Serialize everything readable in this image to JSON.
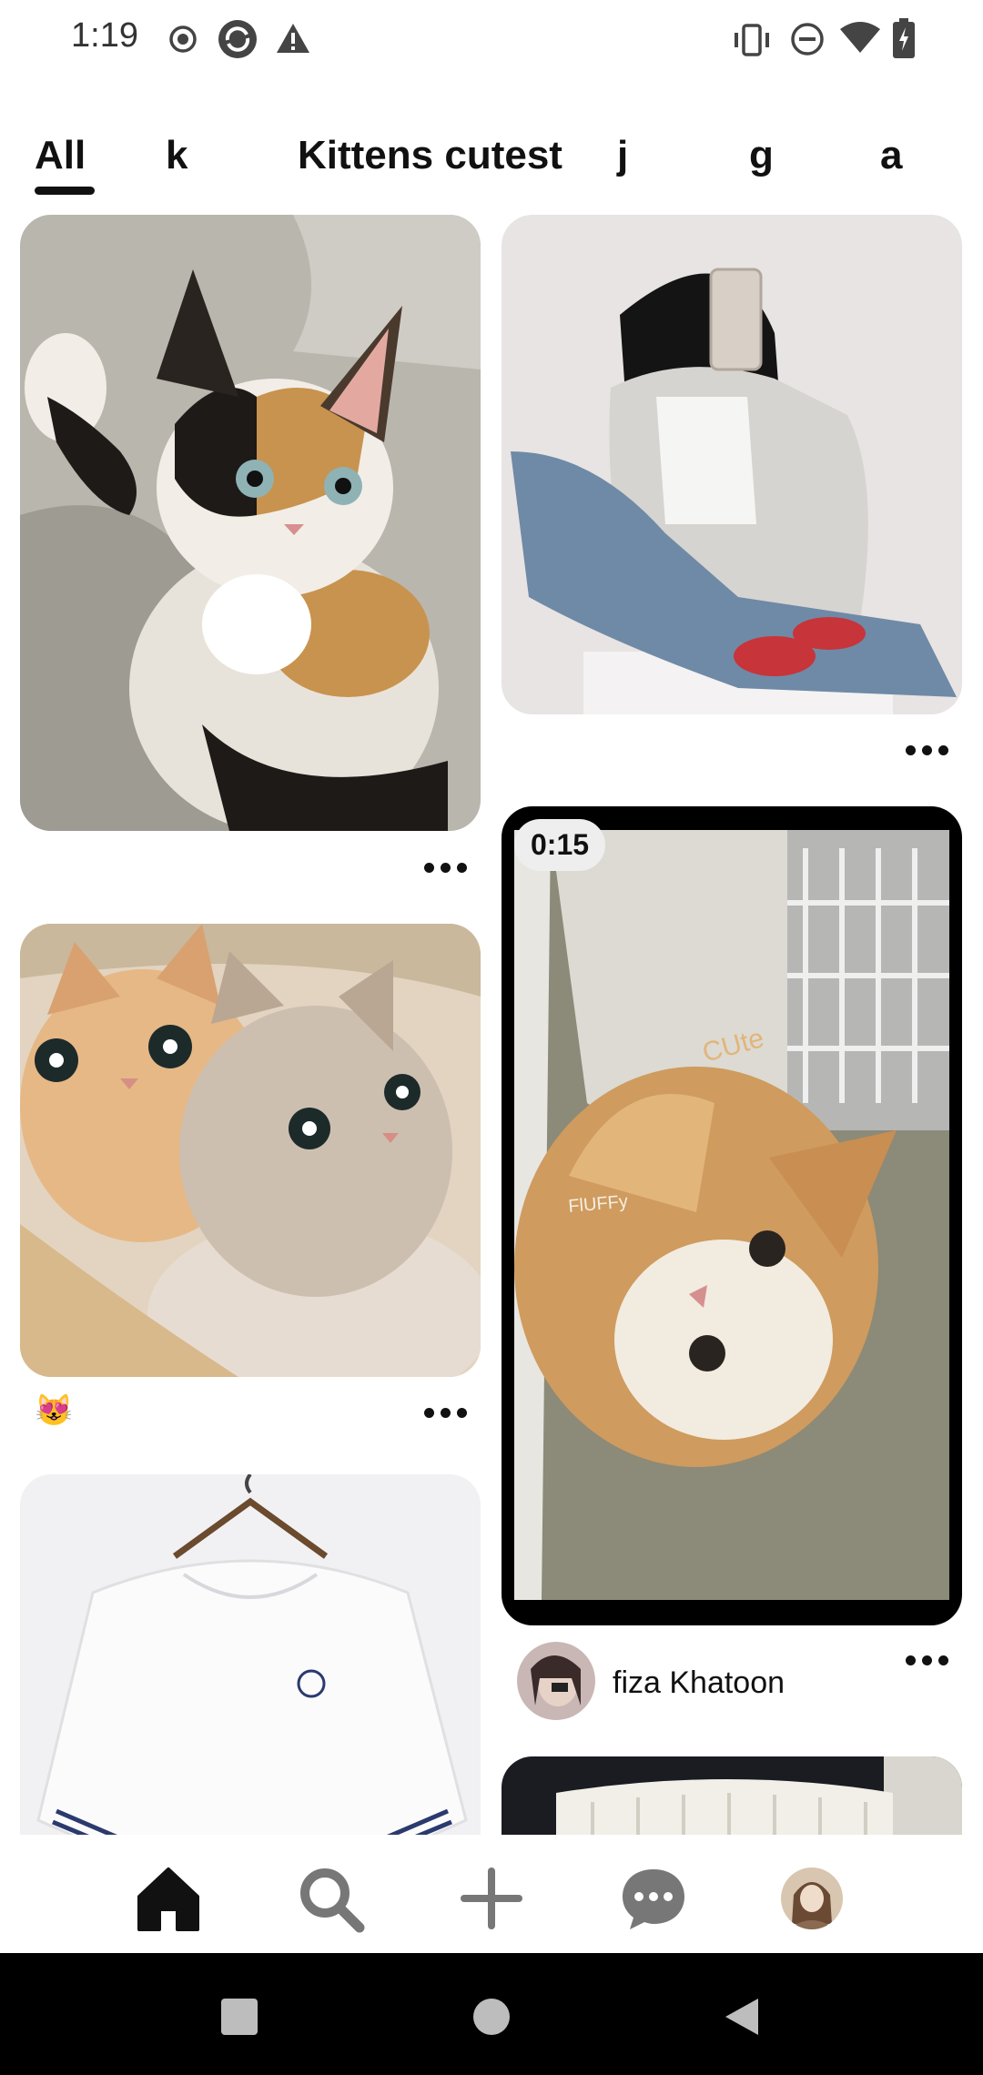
{
  "status_bar": {
    "time": "1:19",
    "left_icons": [
      "record-icon",
      "sync-icon",
      "warning-icon"
    ],
    "right_icons": [
      "vibrate-icon",
      "do-not-disturb-icon",
      "wifi-icon",
      "battery-icon"
    ]
  },
  "tabs": {
    "items": [
      {
        "label": "All",
        "selected": true
      },
      {
        "label": "k",
        "selected": false
      },
      {
        "label": "Kittens cutest",
        "selected": false
      },
      {
        "label": "j",
        "selected": false
      },
      {
        "label": "g",
        "selected": false
      },
      {
        "label": "a",
        "selected": false
      }
    ]
  },
  "feed": {
    "pins": [
      {
        "description": "calico kitten photo",
        "has_more_menu": true
      },
      {
        "description": "girl in hoodie mirror selfie photo",
        "has_more_menu": true
      },
      {
        "description": "two fluffy kittens photo",
        "emoji": "😻",
        "has_more_menu": true
      },
      {
        "description": "cat video",
        "duration": "0:15",
        "author": "fiza Khatoon",
        "has_more_menu": true
      },
      {
        "description": "white hoodie on hanger photo"
      },
      {
        "description": "white pleated object photo"
      }
    ]
  },
  "bottom_nav": {
    "items": [
      "home-icon",
      "search-icon",
      "create-icon",
      "messages-icon",
      "profile-avatar"
    ],
    "active": "home-icon"
  },
  "system_nav": {
    "items": [
      "recents-button",
      "home-button",
      "back-button"
    ]
  },
  "colors": {
    "text": "#111111",
    "background": "#ffffff",
    "system_nav": "#000000"
  }
}
